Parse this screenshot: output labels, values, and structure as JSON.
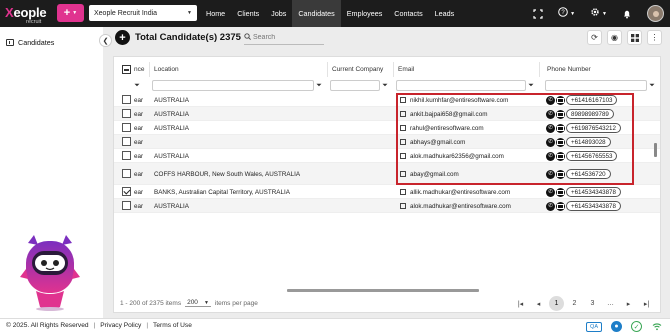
{
  "brand": {
    "logo_text": "eople",
    "logo_x": "X",
    "logo_sub": "recruit"
  },
  "header": {
    "add_label": "+",
    "tenant": "Xeople Recruit India",
    "nav": [
      "Home",
      "Clients",
      "Jobs",
      "Candidates",
      "Employees",
      "Contacts",
      "Leads"
    ],
    "active_nav": "Candidates"
  },
  "sidebar": {
    "items": [
      {
        "label": "Candidates",
        "icon": "candidates-icon"
      }
    ]
  },
  "page": {
    "title": "Total Candidate(s) 2375",
    "search_placeholder": "Search"
  },
  "table": {
    "columns": {
      "col1": "nce",
      "location": "Location",
      "company": "Current Company",
      "email": "Email",
      "phone": "Phone Number"
    },
    "rows": [
      {
        "c1": "ear",
        "location": "AUSTRALIA",
        "email": "nikhil.kumhfar@entiresoftware.com",
        "phone": "+61416167103",
        "checked": false
      },
      {
        "c1": "ear",
        "location": "AUSTRALIA",
        "email": "ankit.bajpai658@gmail.com",
        "phone": "89898989789",
        "checked": false
      },
      {
        "c1": "ear",
        "location": "AUSTRALIA",
        "email": "rahul@entiresoftware.com",
        "phone": "+619876543212",
        "checked": false
      },
      {
        "c1": "ear",
        "location": "",
        "email": "abhays@gmail.com",
        "phone": "+614893028",
        "checked": false
      },
      {
        "c1": "ear",
        "location": "AUSTRALIA",
        "email": "alok.madhukar62356@gmail.com",
        "phone": "+61456765553",
        "checked": false
      },
      {
        "c1": "ear",
        "location": "COFFS HARBOUR, New South Wales, AUSTRALIA",
        "email": "abay@gmail.com",
        "phone": "+614536720",
        "checked": false
      },
      {
        "c1": "ear",
        "location": "BANKS, Australian Capital Territory, AUSTRALIA",
        "email": "allik.madhukar@entiresoftware.com",
        "phone": "+614534343878",
        "checked": true
      },
      {
        "c1": "ear",
        "location": "AUSTRALIA",
        "email": "alok.madhukar@entiresoftware.com",
        "phone": "+614534343878",
        "checked": false
      }
    ]
  },
  "pagination": {
    "range_text": "1 - 200 of 2375 items",
    "per_page": "200",
    "per_page_suffix": "items per page",
    "pages": [
      "1",
      "2",
      "3"
    ],
    "current_page": "1"
  },
  "footer": {
    "copyright": "© 2025. All Rights Reserved",
    "privacy": "Privacy Policy",
    "terms": "Terms of Use",
    "qa": "QA"
  },
  "colors": {
    "accent": "#e0338f",
    "highlight": "#c8242c",
    "topbar": "#1c1c1c"
  }
}
